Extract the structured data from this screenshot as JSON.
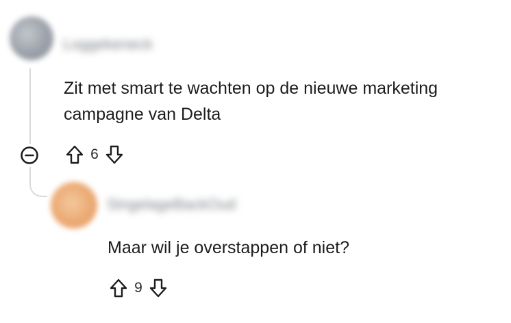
{
  "comments": [
    {
      "username": "Loggekeneck",
      "body": "Zit met smart te wachten op de nieuwe marketing campagne van Delta",
      "votes": "6",
      "avatar_color": "#9aa0a8"
    },
    {
      "username": "SingelageBackOud",
      "body": "Maar wil je overstappen of niet?",
      "votes": "9",
      "avatar_color": "#eba972"
    }
  ],
  "icons": {
    "collapse": "minus-circle-icon",
    "upvote": "arrow-up-icon",
    "downvote": "arrow-down-icon"
  },
  "colors": {
    "text": "#1c1c1c",
    "thread_line": "#d7dadd",
    "icon": "#1c1c1c"
  }
}
